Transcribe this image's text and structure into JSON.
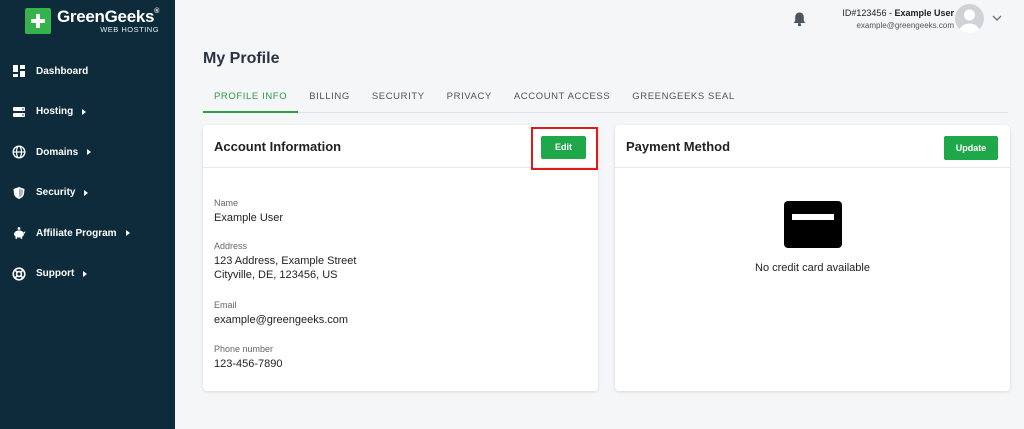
{
  "brand": {
    "name": "GreenGeeks",
    "sub": "WEB HOSTING",
    "color": "#35b24a"
  },
  "sidebar": {
    "items": [
      {
        "label": "Dashboard",
        "icon": "dashboard-icon",
        "caret": false
      },
      {
        "label": "Hosting",
        "icon": "server-icon",
        "caret": true
      },
      {
        "label": "Domains",
        "icon": "globe-icon",
        "caret": true
      },
      {
        "label": "Security",
        "icon": "shield-icon",
        "caret": true
      },
      {
        "label": "Affiliate Program",
        "icon": "piggy-bank-icon",
        "caret": true
      },
      {
        "label": "Support",
        "icon": "lifebuoy-icon",
        "caret": true
      }
    ]
  },
  "header": {
    "user_id": "ID#123456 - ",
    "user_name": "Example User",
    "email": "example@greengeeks.com"
  },
  "page": {
    "title": "My Profile"
  },
  "tabs": [
    {
      "label": "PROFILE INFO",
      "active": true
    },
    {
      "label": "BILLING",
      "active": false
    },
    {
      "label": "SECURITY",
      "active": false
    },
    {
      "label": "PRIVACY",
      "active": false
    },
    {
      "label": "ACCOUNT ACCESS",
      "active": false
    },
    {
      "label": "GREENGEEKS SEAL",
      "active": false
    }
  ],
  "account": {
    "title": "Account Information",
    "edit_label": "Edit",
    "fields": {
      "name_label": "Name",
      "name_value": "Example User",
      "address_label": "Address",
      "address_line1": "123 Address, Example Street",
      "address_line2": "Cityville, DE, 123456, US",
      "email_label": "Email",
      "email_value": "example@greengeeks.com",
      "phone_label": "Phone number",
      "phone_value": "123-456-7890"
    }
  },
  "payment": {
    "title": "Payment Method",
    "update_label": "Update",
    "empty_text": "No credit card available"
  },
  "colors": {
    "sidebar_bg": "#0d2b3a",
    "accent_green": "#1fa84a",
    "highlight_red": "#e01a1a"
  }
}
